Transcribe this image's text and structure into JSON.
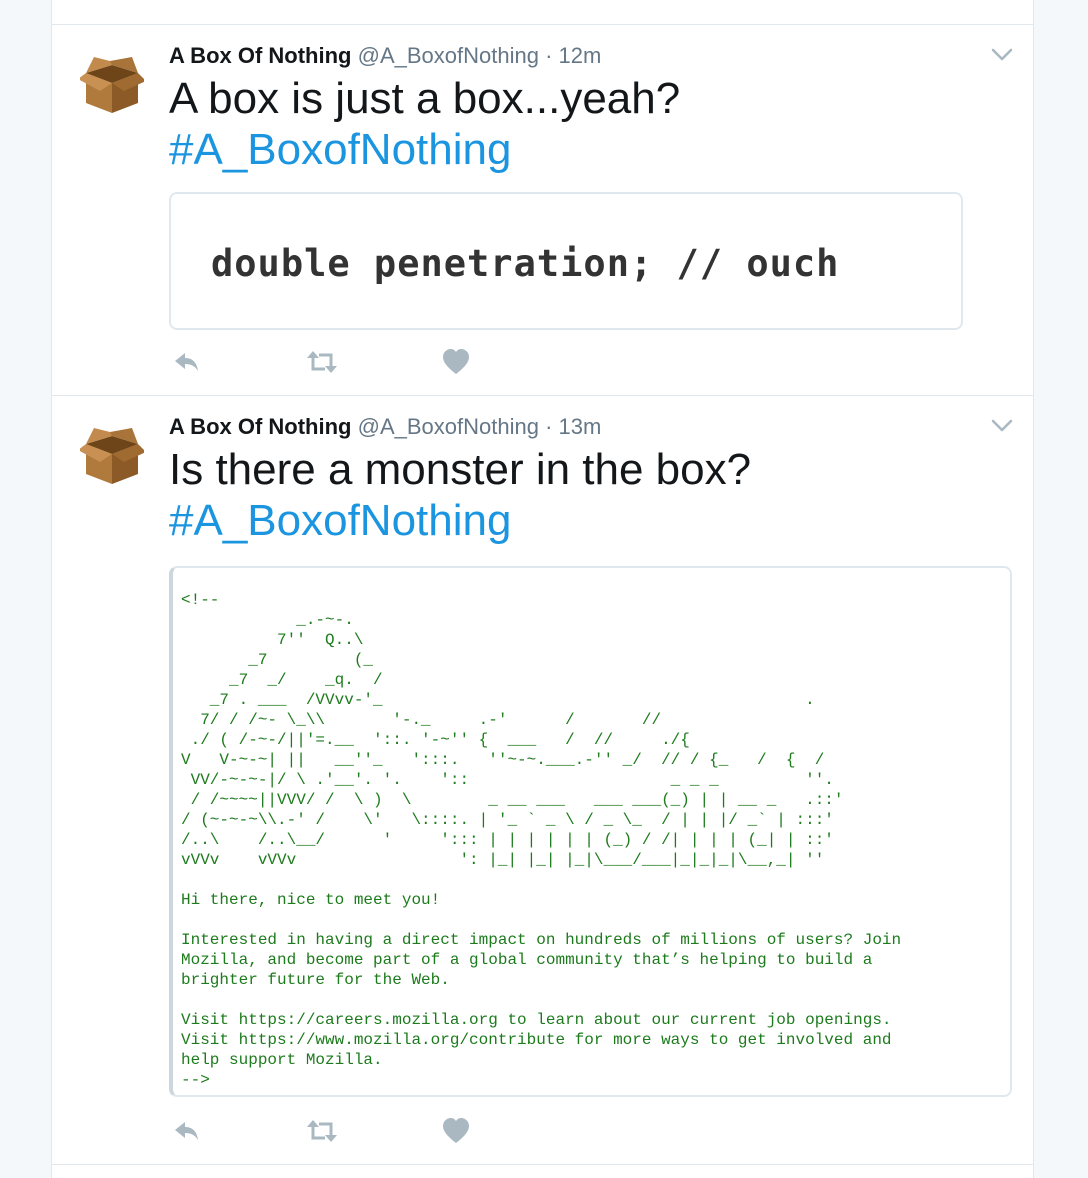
{
  "tweets": [
    {
      "author_name": "A Box Of Nothing",
      "handle": "@A_BoxofNothing",
      "separator": "·",
      "time": "12m",
      "text": "A box is just a box...yeah?",
      "hashtag": "#A_BoxofNothing",
      "media_text": "double penetration; // ouch"
    },
    {
      "author_name": "A Box Of Nothing",
      "handle": "@A_BoxofNothing",
      "separator": "·",
      "time": "13m",
      "text": "Is there a monster in the box?",
      "hashtag": "#A_BoxofNothing",
      "media_text": "<!--\n            _.-~-.\n          7''  Q..\\\n       _7         (_\n     _7  _/    _q.  /\n   _7 . ___  /VVvv-'_                                            .\n  7/ / /~- \\_\\\\       '-._     .-'      /       //\n ./ ( /-~-/||'=.__  '::. '-~'' {  ___   /  //     ./{\nV   V-~-~| ||   __''_   ':::.   ''~-~.___.-'' _/  // / {_   /  {  /\n VV/-~-~-|/ \\ .'__'. '.    '::                     _ _ _         ''.\n / /~~~~||VVV/ /  \\ )  \\        _ __ ___   ___ ___(_) | | __ _   .::'\n/ (~-~-~\\\\.-' /    \\'   \\::::. | '_ ` _ \\ / _ \\_  / | | |/ _` | :::'\n/..\\    /..\\__/      '     '::: | | | | | | (_) / /| | | | (_| | ::'\nvVVv    vVVv                 ': |_| |_| |_|\\___/___|_|_|_|\\__,_| ''\n\nHi there, nice to meet you!\n\nInterested in having a direct impact on hundreds of millions of users? Join\nMozilla, and become part of a global community that’s helping to build a\nbrighter future for the Web.\n\nVisit https://careers.mozilla.org to learn about our current job openings.\nVisit https://www.mozilla.org/contribute for more ways to get involved and\nhelp support Mozilla.\n-->"
    }
  ],
  "icons": {
    "avatar": "cardboard-box-icon",
    "caret": "chevron-down-icon",
    "reply": "reply-icon",
    "retweet": "retweet-icon",
    "like": "heart-icon"
  },
  "colors": {
    "hashtag": "#1b95e0",
    "action_icon": "#aab8c2",
    "comment_text": "#1d7b1d",
    "border": "#e1e8ed"
  }
}
